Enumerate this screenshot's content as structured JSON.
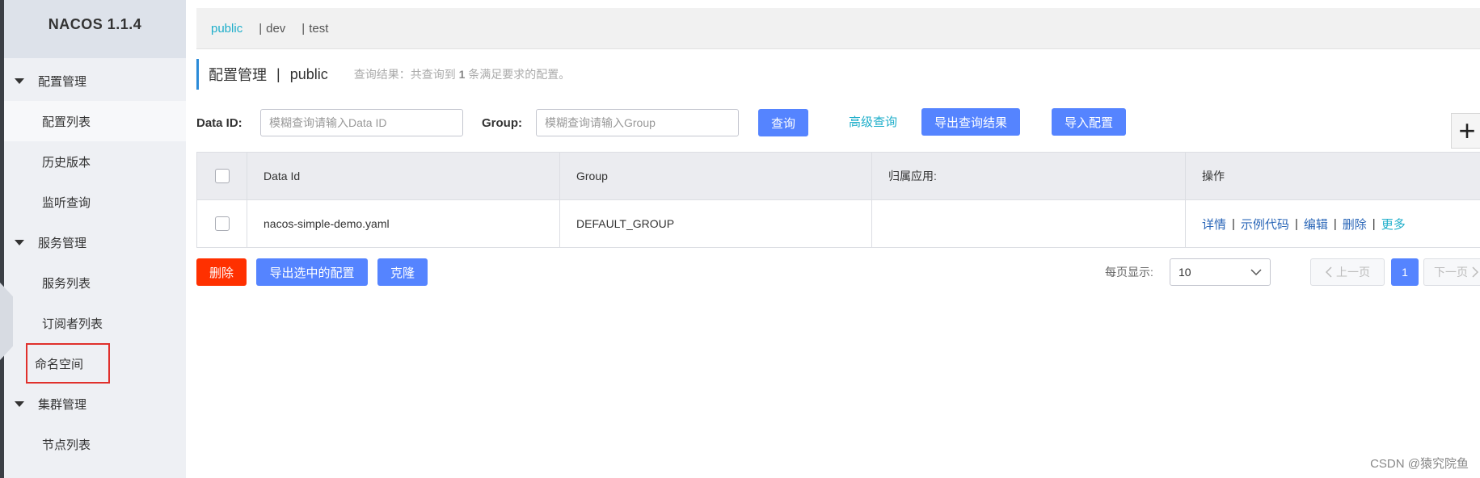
{
  "app": {
    "title": "NACOS 1.1.4"
  },
  "sidebar": {
    "groups": [
      {
        "label": "配置管理",
        "items": [
          {
            "label": "配置列表"
          },
          {
            "label": "历史版本"
          },
          {
            "label": "监听查询"
          }
        ]
      },
      {
        "label": "服务管理",
        "items": [
          {
            "label": "服务列表"
          },
          {
            "label": "订阅者列表"
          }
        ]
      },
      {
        "label": "命名空间"
      },
      {
        "label": "集群管理",
        "items": [
          {
            "label": "节点列表"
          }
        ]
      }
    ]
  },
  "namespaces": [
    {
      "label": "public"
    },
    {
      "label": "dev"
    },
    {
      "label": "test"
    }
  ],
  "namespace_separator": "|",
  "page": {
    "title": "配置管理",
    "title_separator": "|",
    "namespace": "public",
    "hint_prefix": "查询结果：共查询到",
    "hint_count": "1",
    "hint_suffix": "条满足要求的配置。"
  },
  "search": {
    "dataid_label": "Data ID:",
    "dataid_placeholder": "模糊查询请输入Data ID",
    "group_label": "Group:",
    "group_placeholder": "模糊查询请输入Group",
    "query_btn": "查询",
    "advanced_link": "高级查询",
    "export_results_btn": "导出查询结果",
    "import_btn": "导入配置",
    "add_btn": "+"
  },
  "table": {
    "columns": [
      "Data Id",
      "Group",
      "归属应用:",
      "操作"
    ],
    "rows": [
      {
        "data_id": "nacos-simple-demo.yaml",
        "group": "DEFAULT_GROUP",
        "app": "",
        "ops": {
          "detail": "详情",
          "sample": "示例代码",
          "edit": "编辑",
          "delete": "删除",
          "more": "更多",
          "sep": "|"
        }
      }
    ]
  },
  "bulk": {
    "delete_btn": "删除",
    "export_selected_btn": "导出选中的配置",
    "clone_btn": "克隆"
  },
  "pagination": {
    "page_size_label": "每页显示:",
    "page_size": "10",
    "prev": "上一页",
    "current": "1",
    "next": "下一页"
  },
  "watermark": "CSDN @猿究院鱼",
  "colors": {
    "primary": "#5584ff",
    "danger": "#ff3000",
    "link": "#2b67b8",
    "accent_link": "#1eaeca",
    "highlight_border": "#e0302c"
  }
}
